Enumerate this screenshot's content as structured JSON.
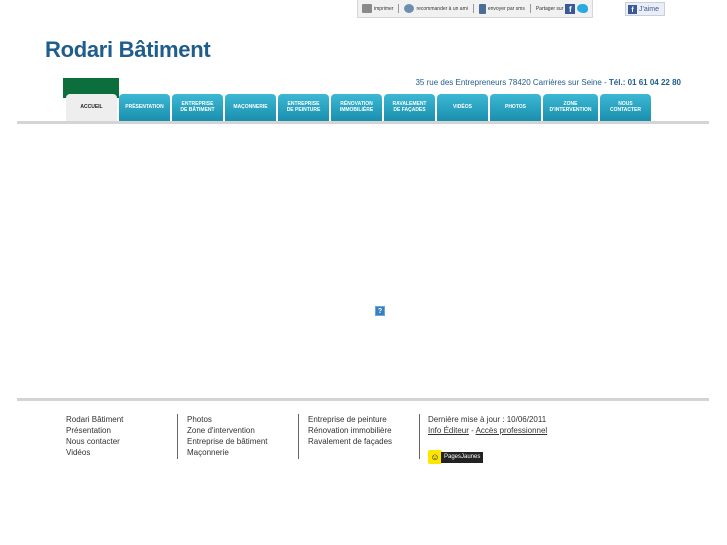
{
  "toolbar": {
    "print": "imprimer",
    "recommend": "recommander à un ami",
    "sms": "envoyer par sms",
    "share": "Partager sur",
    "like": "J'aime"
  },
  "site_title": "Rodari Bâtiment",
  "address": "35 rue des Entrepreneurs 78420 Carrières sur Seine",
  "address_sep": " - ",
  "tel_label": "Tél.:",
  "tel": "01 61 04 22 80",
  "nav": [
    {
      "label": "ACCUEIL"
    },
    {
      "label": "PRÉSENTATION"
    },
    {
      "label": "ENTREPRISE\nDE BÂTIMENT"
    },
    {
      "label": "MAÇONNERIE"
    },
    {
      "label": "ENTREPRISE\nDE PEINTURE"
    },
    {
      "label": "RÉNOVATION\nIMMOBILIÈRE"
    },
    {
      "label": "RAVALEMENT\nDE FAÇADES"
    },
    {
      "label": "VIDÉOS"
    },
    {
      "label": "PHOTOS"
    },
    {
      "label": "ZONE\nD'INTERVENTION"
    },
    {
      "label": "NOUS\nCONTACTER"
    }
  ],
  "plugin_icon": "?",
  "footer": {
    "col1": [
      "Rodari Bâtiment",
      "Présentation",
      "Nous contacter",
      "Vidéos"
    ],
    "col2": [
      "Photos",
      "Zone d'intervention",
      "Entreprise de bâtiment",
      "Maçonnerie"
    ],
    "col3": [
      "Entreprise de peinture",
      "Rénovation immobilière",
      "Ravalement de façades"
    ],
    "updated": "Dernière mise à jour : 10/06/2011",
    "info_editeur": "Info Éditeur",
    "link_sep": " - ",
    "acces_pro": "Accès professionnel",
    "pj_label": "PagesJaunes"
  }
}
